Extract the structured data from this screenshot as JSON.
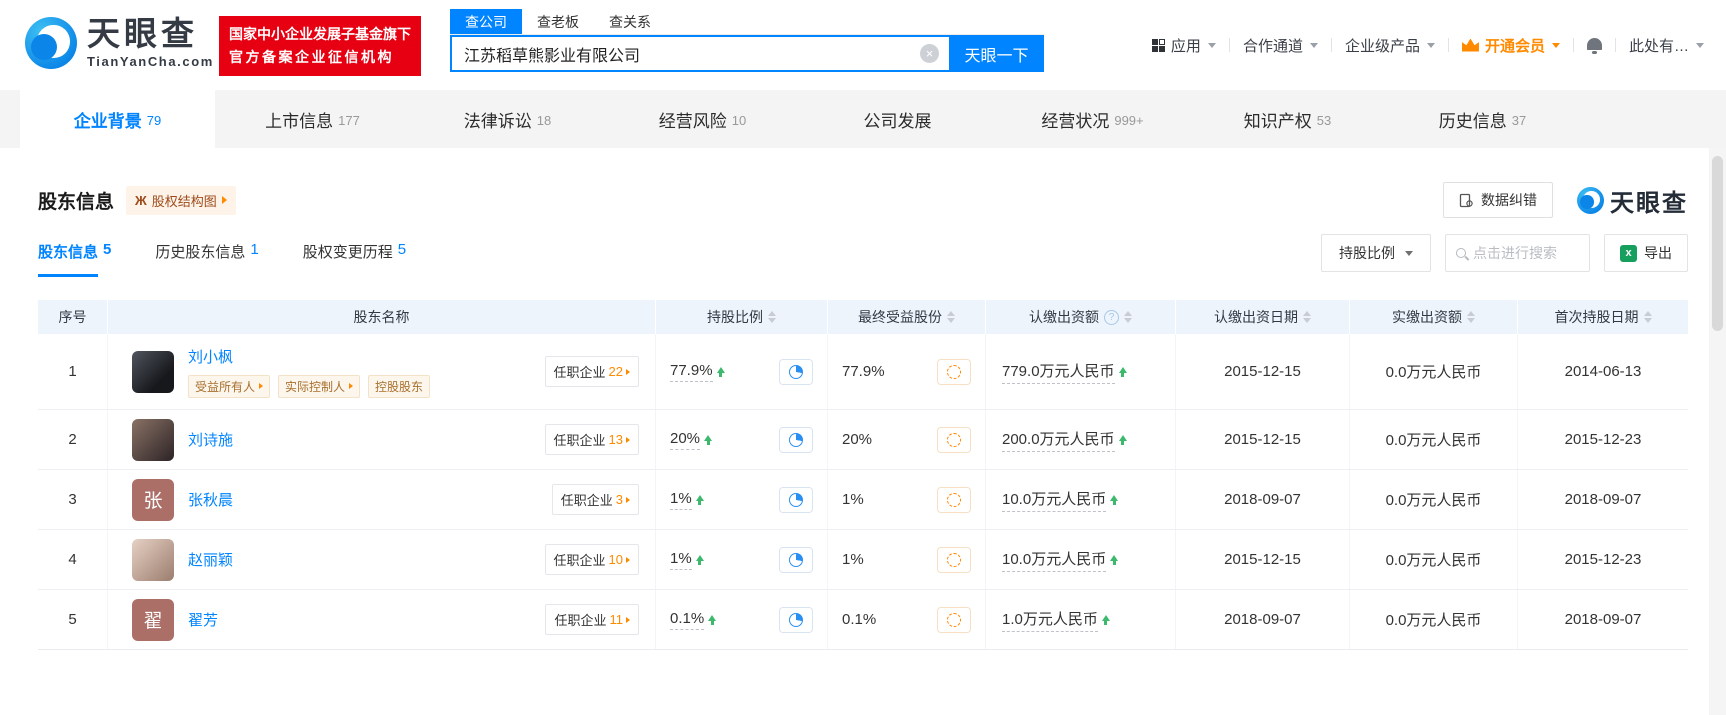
{
  "header": {
    "logo": {
      "brand": "天眼查",
      "domain": "TianYanCha.com"
    },
    "badge": {
      "line1": "国家中小企业发展子基金旗下",
      "line2": "官方备案企业征信机构"
    },
    "search": {
      "tabs": [
        {
          "label": "查公司",
          "active": true
        },
        {
          "label": "查老板",
          "active": false
        },
        {
          "label": "查关系",
          "active": false
        }
      ],
      "value": "江苏稻草熊影业有限公司",
      "button": "天眼一下"
    },
    "nav": [
      {
        "label": "应用",
        "icon": "grid",
        "caret": true,
        "accent": false
      },
      {
        "label": "合作通道",
        "icon": "",
        "caret": true,
        "accent": false
      },
      {
        "label": "企业级产品",
        "icon": "",
        "caret": true,
        "accent": false
      },
      {
        "label": "开通会员",
        "icon": "crown",
        "caret": true,
        "accent": true
      },
      {
        "label": "",
        "icon": "bell",
        "caret": false,
        "accent": false
      },
      {
        "label": "此处有…",
        "icon": "",
        "caret": true,
        "accent": false
      }
    ]
  },
  "tabs": [
    {
      "label": "企业背景",
      "count": "79",
      "active": true
    },
    {
      "label": "上市信息",
      "count": "177",
      "active": false
    },
    {
      "label": "法律诉讼",
      "count": "18",
      "active": false
    },
    {
      "label": "经营风险",
      "count": "10",
      "active": false
    },
    {
      "label": "公司发展",
      "count": "",
      "active": false
    },
    {
      "label": "经营状况",
      "count": "999+",
      "active": false
    },
    {
      "label": "知识产权",
      "count": "53",
      "active": false
    },
    {
      "label": "历史信息",
      "count": "37",
      "active": false
    }
  ],
  "section": {
    "title": "股东信息",
    "structure_button": "股权结构图",
    "correction_button": "数据纠错",
    "watermark": "天眼查",
    "subtabs": [
      {
        "label": "股东信息",
        "count": "5",
        "active": true
      },
      {
        "label": "历史股东信息",
        "count": "1",
        "active": false
      },
      {
        "label": "股权变更历程",
        "count": "5",
        "active": false
      }
    ],
    "filter_dropdown": "持股比例",
    "search_placeholder": "点击进行搜索",
    "export_button": "导出"
  },
  "table": {
    "jobs_label": "任职企业",
    "columns": [
      {
        "label": "序号",
        "sortable": false,
        "info": false
      },
      {
        "label": "股东名称",
        "sortable": false,
        "info": false
      },
      {
        "label": "持股比例",
        "sortable": true,
        "info": false
      },
      {
        "label": "最终受益股份",
        "sortable": true,
        "info": false
      },
      {
        "label": "认缴出资额",
        "sortable": true,
        "info": true
      },
      {
        "label": "认缴出资日期",
        "sortable": true,
        "info": false
      },
      {
        "label": "实缴出资额",
        "sortable": true,
        "info": false
      },
      {
        "label": "首次持股日期",
        "sortable": true,
        "info": false
      }
    ],
    "rows": [
      {
        "index": "1",
        "name": "刘小枫",
        "avatar": {
          "kind": "photo",
          "tone": "dark",
          "text": ""
        },
        "tags": [
          {
            "label": "受益所有人",
            "arrow": true
          },
          {
            "label": "实际控制人",
            "arrow": true
          },
          {
            "label": "控股股东",
            "arrow": false
          }
        ],
        "jobs_count": "22",
        "ratio": "77.9%",
        "ratio_up": true,
        "benefit": "77.9%",
        "subscribed": "779.0万元人民币",
        "subscribed_up": true,
        "subscribed_date": "2015-12-15",
        "paid": "0.0万元人民币",
        "first_date": "2014-06-13"
      },
      {
        "index": "2",
        "name": "刘诗施",
        "avatar": {
          "kind": "photo",
          "tone": "warm",
          "text": ""
        },
        "tags": [],
        "jobs_count": "13",
        "ratio": "20%",
        "ratio_up": true,
        "benefit": "20%",
        "subscribed": "200.0万元人民币",
        "subscribed_up": true,
        "subscribed_date": "2015-12-15",
        "paid": "0.0万元人民币",
        "first_date": "2015-12-23"
      },
      {
        "index": "3",
        "name": "张秋晨",
        "avatar": {
          "kind": "text",
          "tone": "",
          "text": "张"
        },
        "tags": [],
        "jobs_count": "3",
        "ratio": "1%",
        "ratio_up": true,
        "benefit": "1%",
        "subscribed": "10.0万元人民币",
        "subscribed_up": true,
        "subscribed_date": "2018-09-07",
        "paid": "0.0万元人民币",
        "first_date": "2018-09-07"
      },
      {
        "index": "4",
        "name": "赵丽颖",
        "avatar": {
          "kind": "photo",
          "tone": "light",
          "text": ""
        },
        "tags": [],
        "jobs_count": "10",
        "ratio": "1%",
        "ratio_up": true,
        "benefit": "1%",
        "subscribed": "10.0万元人民币",
        "subscribed_up": true,
        "subscribed_date": "2015-12-15",
        "paid": "0.0万元人民币",
        "first_date": "2015-12-23"
      },
      {
        "index": "5",
        "name": "翟芳",
        "avatar": {
          "kind": "text",
          "tone": "",
          "text": "翟"
        },
        "tags": [],
        "jobs_count": "11",
        "ratio": "0.1%",
        "ratio_up": true,
        "benefit": "0.1%",
        "subscribed": "1.0万元人民币",
        "subscribed_up": true,
        "subscribed_date": "2018-09-07",
        "paid": "0.0万元人民币",
        "first_date": "2018-09-07"
      }
    ]
  },
  "colors": {
    "brand_blue": "#0084ff",
    "badge_red": "#e60012",
    "accent_orange": "#ff8a00",
    "up_green": "#3cb96d",
    "table_header_bg": "#edf4fc",
    "tabbar_bg": "#f4f4f4"
  }
}
